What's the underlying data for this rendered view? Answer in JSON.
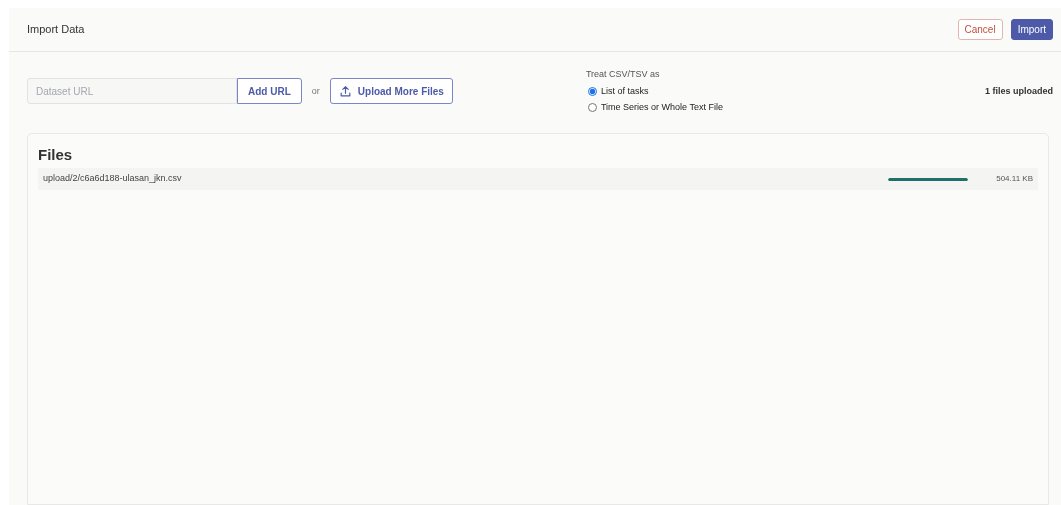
{
  "header": {
    "title": "Import Data",
    "buttons": [
      {
        "label": "Cancel",
        "kind": "cancel"
      },
      {
        "label": "Import",
        "kind": "primary"
      }
    ]
  },
  "url_input": {
    "placeholder": "Dataset URL",
    "button": "Add URL"
  },
  "separator": "or",
  "upload_button": "Upload More Files",
  "treat_as": {
    "label": "Treat CSV/TSV as",
    "options": [
      {
        "label": "List of tasks",
        "selected": true
      },
      {
        "label": "Time Series or Whole Text File",
        "selected": false
      }
    ]
  },
  "upload_count": "1 files uploaded",
  "files": {
    "title": "Files",
    "items": [
      {
        "path": "upload/2/c6a6d188-ulasan_jkn.csv",
        "level": 1,
        "size": "504.11 KB"
      }
    ]
  }
}
